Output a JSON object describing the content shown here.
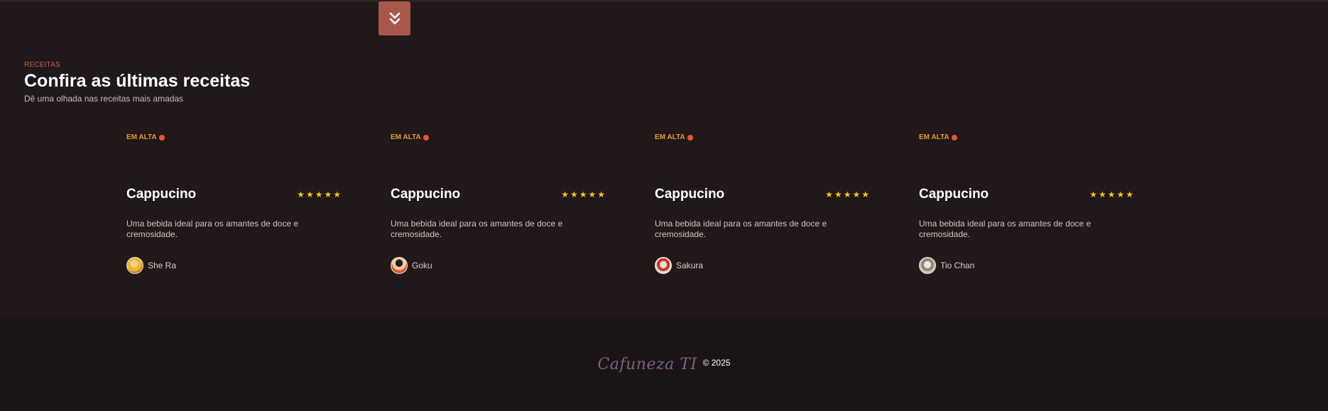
{
  "section": {
    "eyebrow": "RECEITAS",
    "title": "Confira as últimas receitas",
    "subtitle": "Dê uma olhada nas receitas mais amadas"
  },
  "cards": [
    {
      "badge": "EM ALTA",
      "title": "Cappucino",
      "rating": 5,
      "description": "Uma bebida ideal para os amantes de doce e cremosidade.",
      "author": "She Ra",
      "avatar_color": "#e9b83a"
    },
    {
      "badge": "EM ALTA",
      "title": "Cappucino",
      "rating": 5,
      "description": "Uma bebida ideal para os amantes de doce e cremosidade.",
      "author": "Goku",
      "avatar_color": "#e2552b"
    },
    {
      "badge": "EM ALTA",
      "title": "Cappucino",
      "rating": 5,
      "description": "Uma bebida ideal para os amantes de doce e cremosidade.",
      "author": "Sakura",
      "avatar_color": "#d7a7a0"
    },
    {
      "badge": "EM ALTA",
      "title": "Cappucino",
      "rating": 5,
      "description": "Uma bebida ideal para os amantes de doce e cremosidade.",
      "author": "Tio Chan",
      "avatar_color": "#b8b4a4"
    }
  ],
  "footer": {
    "logo": "Cafuneza TI",
    "copyright": "© 2025"
  },
  "colors": {
    "background": "#201819",
    "accent": "#a8574a",
    "badge": "#e69a2a",
    "star": "#f5c518"
  },
  "icons": {
    "scroll_button": "double-chevron-down-icon",
    "badge": "flame-icon",
    "rating": "star-icon"
  }
}
